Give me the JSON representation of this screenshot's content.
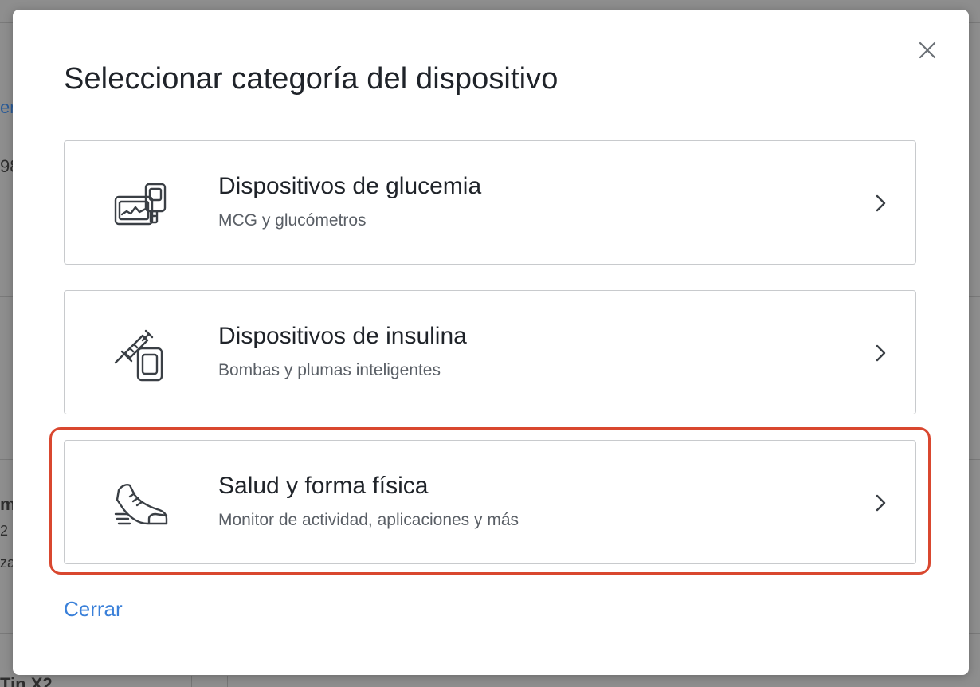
{
  "background": {
    "fragments": [
      "er",
      "98",
      "m",
      "2",
      "za",
      "Tin X2"
    ]
  },
  "modal": {
    "title": "Seleccionar categoría del dispositivo",
    "close_icon": "close-icon",
    "options": [
      {
        "title": "Dispositivos de glucemia",
        "subtitle": "MCG y glucómetros",
        "icon": "glucose-meter-icon"
      },
      {
        "title": "Dispositivos de insulina",
        "subtitle": "Bombas y plumas inteligentes",
        "icon": "insulin-syringe-icon"
      },
      {
        "title": "Salud y forma física",
        "subtitle": "Monitor de actividad, aplicaciones y más",
        "icon": "sneaker-icon"
      }
    ],
    "close_label": "Cerrar"
  },
  "colors": {
    "accent": "#3a80d9",
    "highlight": "#d9472f",
    "text": "#1f2329",
    "subtext": "#5a5f66",
    "border": "#c8cacd"
  }
}
